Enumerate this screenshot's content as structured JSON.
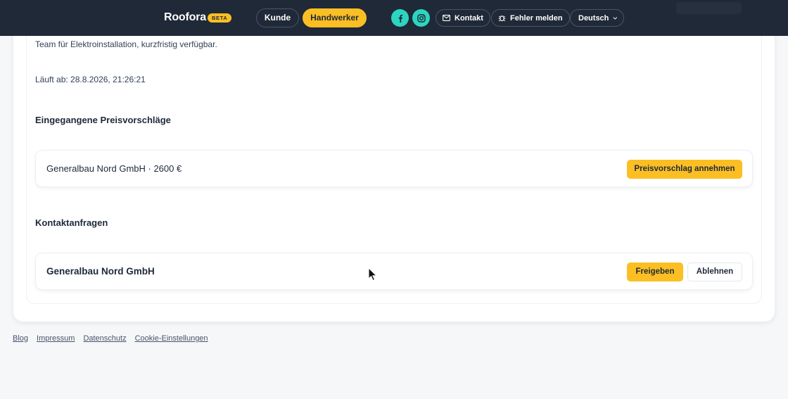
{
  "header": {
    "brand": "Roofora",
    "badge": "BETA",
    "tabs": [
      {
        "label": "Kunde",
        "active": false
      },
      {
        "label": "Handwerker",
        "active": true
      }
    ],
    "social": [
      "facebook-icon",
      "instagram-icon"
    ],
    "contact_label": "Kontakt",
    "report_label": "Fehler melden",
    "language": "Deutsch"
  },
  "job": {
    "description": "Team für Elektroinstallation, kurzfristig verfügbar.",
    "expires": "Läuft ab: 28.8.2026, 21:26:21"
  },
  "quotes": {
    "title": "Eingegangene Preisvorschläge",
    "items": [
      {
        "text": "Generalbau Nord GmbH · 2600 €",
        "accept_label": "Preisvorschlag annehmen"
      }
    ]
  },
  "contacts": {
    "title": "Kontaktanfragen",
    "items": [
      {
        "name": "Generalbau Nord GmbH",
        "approve_label": "Freigeben",
        "reject_label": "Ablehnen"
      }
    ]
  },
  "footer": {
    "links": [
      "Blog",
      "Impressum",
      "Datenschutz",
      "Cookie-Einstellungen"
    ]
  },
  "colors": {
    "header_bg": "#1f2937",
    "accent": "#fbbf24",
    "social": "#2dd4bf",
    "page_bg": "#f6f7f9"
  }
}
